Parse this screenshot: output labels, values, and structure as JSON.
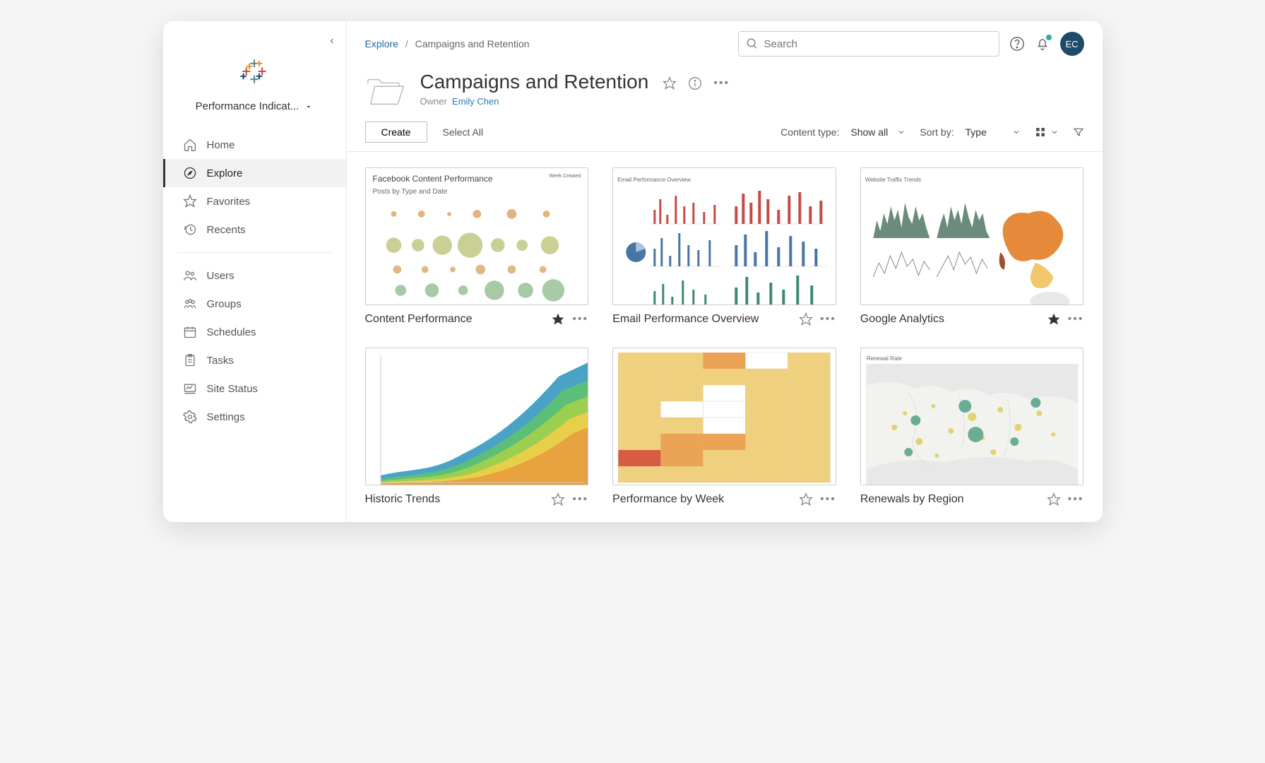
{
  "site_name": "Performance Indicat...",
  "user_initials": "EC",
  "search_placeholder": "Search",
  "breadcrumb": {
    "root": "Explore",
    "current": "Campaigns and Retention"
  },
  "page": {
    "title": "Campaigns and Retention",
    "owner_label": "Owner",
    "owner_name": "Emily Chen"
  },
  "sidebar": {
    "nav1": [
      {
        "label": "Home",
        "icon": "home-icon"
      },
      {
        "label": "Explore",
        "icon": "explore-icon",
        "active": true
      },
      {
        "label": "Favorites",
        "icon": "star-icon"
      },
      {
        "label": "Recents",
        "icon": "recent-icon"
      }
    ],
    "nav2": [
      {
        "label": "Users",
        "icon": "users-icon"
      },
      {
        "label": "Groups",
        "icon": "groups-icon"
      },
      {
        "label": "Schedules",
        "icon": "calendar-icon"
      },
      {
        "label": "Tasks",
        "icon": "clipboard-icon"
      },
      {
        "label": "Site Status",
        "icon": "status-icon"
      },
      {
        "label": "Settings",
        "icon": "gear-icon"
      }
    ]
  },
  "toolbar": {
    "create": "Create",
    "select_all": "Select All",
    "content_type_label": "Content type:",
    "content_type_value": "Show all",
    "sort_label": "Sort by:",
    "sort_value": "Type"
  },
  "cards": [
    {
      "title": "Content Performance",
      "favorite": true,
      "thumb_title": "Facebook Content Performance",
      "thumb_subtitle": "Posts by Type and Date",
      "thumb_note": "Week Created"
    },
    {
      "title": "Email Performance Overview",
      "favorite": false,
      "thumb_title": "Email Performance Overview"
    },
    {
      "title": "Google Analytics",
      "favorite": true,
      "thumb_title": "Website Traffic Trends"
    },
    {
      "title": "Historic Trends",
      "favorite": false
    },
    {
      "title": "Performance by Week",
      "favorite": false
    },
    {
      "title": "Renewals by Region",
      "favorite": false,
      "thumb_title": "Renewal Rate"
    }
  ]
}
